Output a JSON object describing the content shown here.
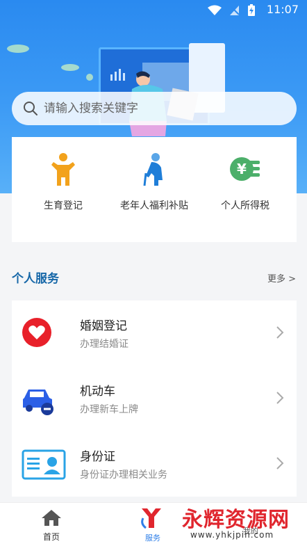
{
  "status_bar": {
    "time": "11:07"
  },
  "search": {
    "placeholder": "请输入搜索关键字"
  },
  "quick_services": [
    {
      "label": "生育登记",
      "icon": "child-icon"
    },
    {
      "label": "老年人福利补贴",
      "icon": "elderly-icon"
    },
    {
      "label": "个人所得税",
      "icon": "yen-coin-icon"
    }
  ],
  "section": {
    "title": "个人服务",
    "more": "更多 >"
  },
  "services": [
    {
      "title": "婚姻登记",
      "subtitle": "办理结婚证",
      "icon": "heart-icon"
    },
    {
      "title": "机动车",
      "subtitle": "办理新车上牌",
      "icon": "car-icon"
    },
    {
      "title": "身份证",
      "subtitle": "身份证办理相关业务",
      "icon": "id-card-icon"
    }
  ],
  "bottom_nav": {
    "home": "首页",
    "service": "服务",
    "mine": "我的"
  },
  "watermark": {
    "text": "永辉资源网",
    "url": "www.yhkjpin.com"
  },
  "colors": {
    "primary": "#2a8af0",
    "accent_red": "#e8202a",
    "car_blue": "#2b5fe6",
    "section_title": "#1667a8"
  }
}
